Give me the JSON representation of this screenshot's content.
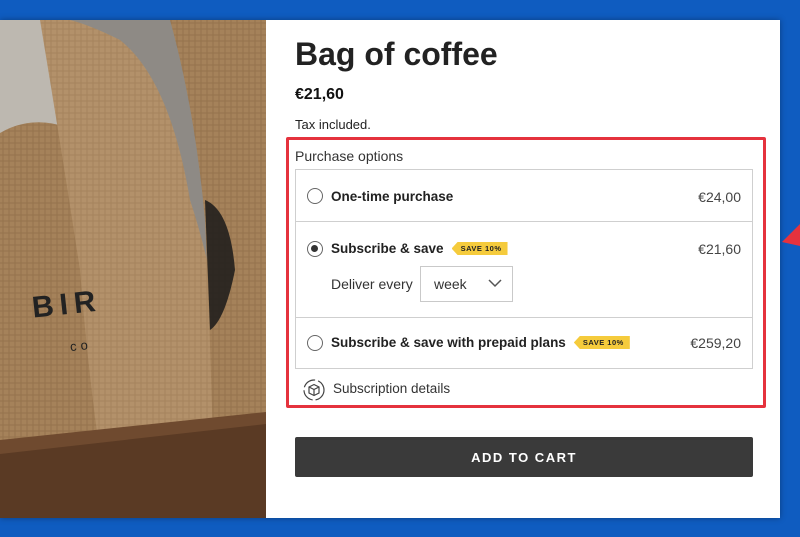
{
  "product": {
    "title": "Bag of coffee",
    "price": "€21,60",
    "tax_note": "Tax included.",
    "image_text": {
      "brand": "BIR",
      "sub": "co"
    }
  },
  "purchase_options": {
    "label": "Purchase options",
    "options": [
      {
        "label": "One-time purchase",
        "price": "€24,00",
        "selected": false
      },
      {
        "label": "Subscribe & save",
        "price": "€21,60",
        "badge": "SAVE 10%",
        "selected": true
      },
      {
        "label": "Subscribe & save with prepaid plans",
        "price": "€259,20",
        "badge": "SAVE 10%",
        "selected": false
      }
    ],
    "deliver_every_label": "Deliver every",
    "deliver_every_value": "week"
  },
  "subscription_details": {
    "label": "Subscription details",
    "icon": "subscription-box-icon"
  },
  "add_to_cart": {
    "label": "ADD TO CART"
  },
  "colors": {
    "background": "#0f5cc0",
    "highlight": "#e5323d",
    "badge": "#f5cb3c",
    "button": "#3a3a3a"
  }
}
